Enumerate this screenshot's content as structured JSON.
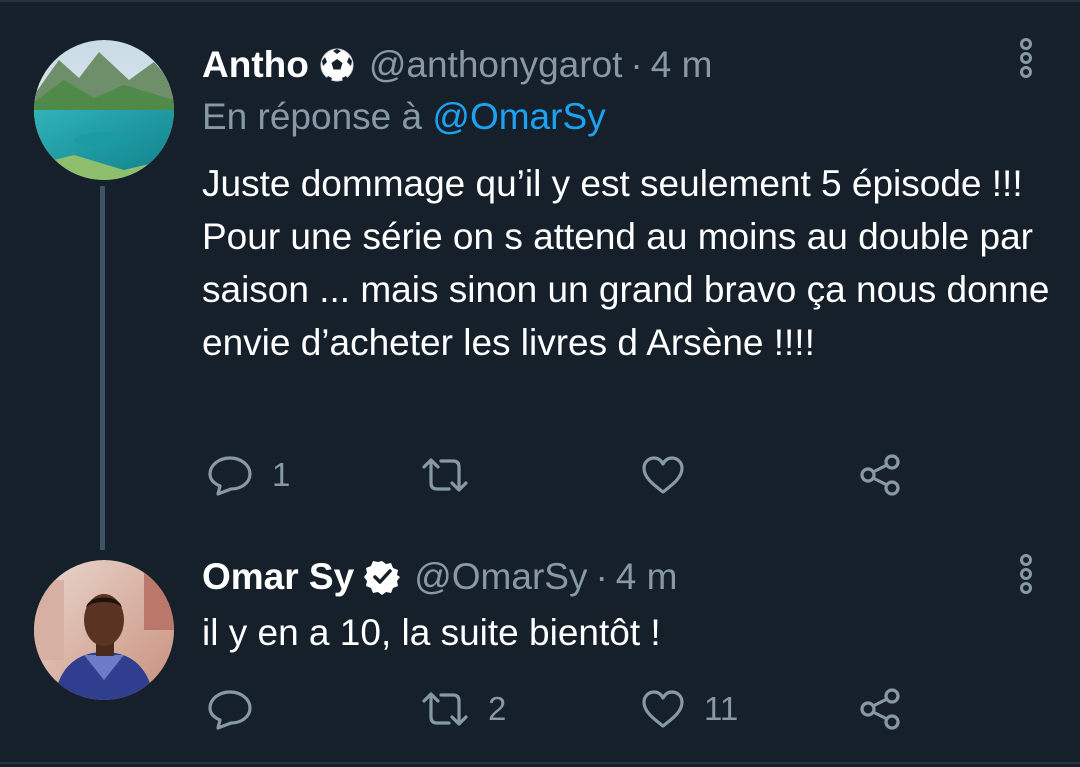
{
  "tweets": [
    {
      "display_name": "Antho",
      "name_icon": "soccer-ball-icon",
      "handle": "@anthonygarot",
      "separator": "·",
      "time": "4 m",
      "reply_prefix": "En réponse à",
      "reply_mention": "@OmarSy",
      "text": "Juste dommage qu’il y est seulement 5 épisode !!! Pour une série on s attend au moins au double par saison ... mais sinon un grand bravo ça nous donne envie d’acheter les livres d Arsène !!!!",
      "actions": {
        "reply_count": "1",
        "retweet_count": "",
        "like_count": ""
      }
    },
    {
      "display_name": "Omar Sy",
      "name_icon": "verified-badge-icon",
      "handle": "@OmarSy",
      "separator": "·",
      "time": "4 m",
      "text": "il y en a 10, la suite bientôt !",
      "actions": {
        "reply_count": "",
        "retweet_count": "2",
        "like_count": "11"
      }
    }
  ],
  "colors": {
    "background": "#15202b",
    "text": "#ffffff",
    "muted": "#8899a6",
    "accent": "#1da1f2",
    "thread_line": "#3d5466"
  }
}
